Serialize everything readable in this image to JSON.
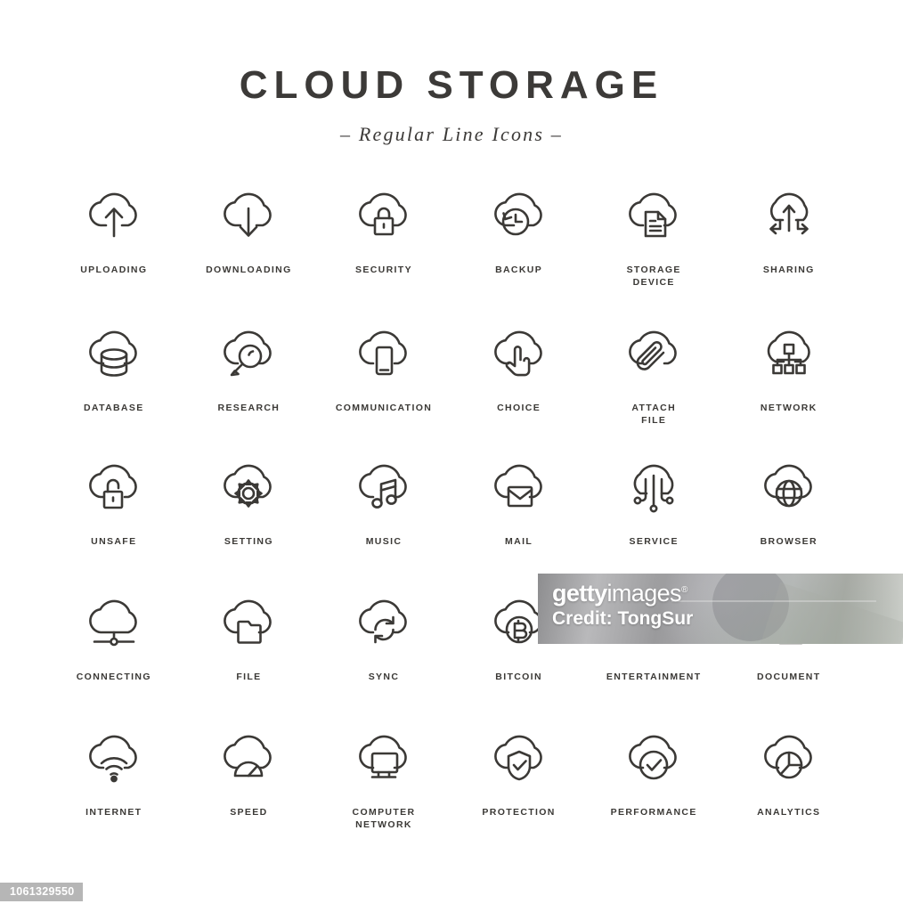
{
  "header": {
    "title": "CLOUD STORAGE",
    "subtitle": "– Regular Line Icons –"
  },
  "watermark": {
    "brand_bold": "getty",
    "brand_light": "images",
    "credit": "Credit: TongSur",
    "id": "1061329550"
  },
  "style": {
    "stroke_color": "#3b3936",
    "label_color": "#3b3936",
    "background": "#ffffff",
    "badge_background": "#b6b6b6"
  },
  "grid": {
    "columns": 6,
    "rows": 5,
    "icons": [
      {
        "label": "UPLOADING",
        "icon": "cloud-upload-arrow-icon"
      },
      {
        "label": "DOWNLOADING",
        "icon": "cloud-download-arrow-icon"
      },
      {
        "label": "SECURITY",
        "icon": "cloud-padlock-closed-icon"
      },
      {
        "label": "BACKUP",
        "icon": "cloud-clock-restore-icon"
      },
      {
        "label": "STORAGE\nDEVICE",
        "icon": "cloud-document-lines-icon"
      },
      {
        "label": "SHARING",
        "icon": "cloud-share-arrows-icon"
      },
      {
        "label": "DATABASE",
        "icon": "cloud-database-cylinder-icon"
      },
      {
        "label": "RESEARCH",
        "icon": "cloud-magnifier-icon"
      },
      {
        "label": "COMMUNICATION",
        "icon": "cloud-smartphone-icon"
      },
      {
        "label": "CHOICE",
        "icon": "cloud-pointing-hand-icon"
      },
      {
        "label": "ATTACH\nFILE",
        "icon": "cloud-paperclip-icon"
      },
      {
        "label": "NETWORK",
        "icon": "cloud-hierarchy-nodes-icon"
      },
      {
        "label": "UNSAFE",
        "icon": "cloud-padlock-open-icon"
      },
      {
        "label": "SETTING",
        "icon": "cloud-gear-icon"
      },
      {
        "label": "MUSIC",
        "icon": "cloud-music-note-icon"
      },
      {
        "label": "MAIL",
        "icon": "cloud-envelope-icon"
      },
      {
        "label": "SERVICE",
        "icon": "cloud-circuit-nodes-icon"
      },
      {
        "label": "BROWSER",
        "icon": "cloud-globe-icon"
      },
      {
        "label": "CONNECTING",
        "icon": "cloud-network-line-icon"
      },
      {
        "label": "FILE",
        "icon": "cloud-folder-icon"
      },
      {
        "label": "SYNC",
        "icon": "cloud-sync-arrows-icon"
      },
      {
        "label": "BITCOIN",
        "icon": "cloud-bitcoin-coin-icon"
      },
      {
        "label": "ENTERTAINMENT",
        "icon": "cloud-clapperboard-play-icon"
      },
      {
        "label": "DOCUMENT",
        "icon": "cloud-document-page-icon"
      },
      {
        "label": "INTERNET",
        "icon": "cloud-wifi-icon"
      },
      {
        "label": "SPEED",
        "icon": "cloud-speedometer-icon"
      },
      {
        "label": "COMPUTER\nNETWORK",
        "icon": "cloud-monitor-icon"
      },
      {
        "label": "PROTECTION",
        "icon": "cloud-shield-check-icon"
      },
      {
        "label": "PERFORMANCE",
        "icon": "cloud-circle-check-icon"
      },
      {
        "label": "ANALYTICS",
        "icon": "cloud-pie-chart-icon"
      }
    ]
  }
}
